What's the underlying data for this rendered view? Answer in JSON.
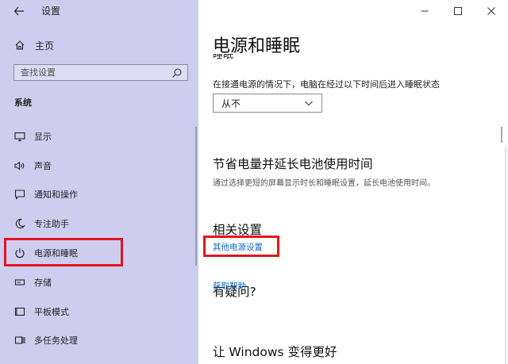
{
  "window": {
    "title": "设置",
    "controls": [
      "minimize",
      "maximize",
      "close"
    ]
  },
  "sidebar": {
    "home_label": "主页",
    "search_placeholder": "查找设置",
    "section": "系统",
    "items": [
      {
        "label": "显示",
        "icon": "display-icon"
      },
      {
        "label": "声音",
        "icon": "speaker-icon"
      },
      {
        "label": "通知和操作",
        "icon": "notification-icon"
      },
      {
        "label": "专注助手",
        "icon": "moon-icon"
      },
      {
        "label": "电源和睡眠",
        "icon": "power-icon",
        "selected": true
      },
      {
        "label": "存储",
        "icon": "storage-icon"
      },
      {
        "label": "平板模式",
        "icon": "tablet-icon"
      },
      {
        "label": "多任务处理",
        "icon": "multitask-icon"
      }
    ]
  },
  "main": {
    "title": "电源和睡眠",
    "subheading_cut": "睡眠",
    "sleep_label": "在接通电源的情况下，电脑在经过以下时间后进入睡眠状态",
    "sleep_value": "从不",
    "save_heading": "节省电量并延长电池使用时间",
    "save_desc": "通过选择更短的屏幕显示时长和睡眠设置，延长电池使用时间。",
    "related_heading": "相关设置",
    "related_link": "其他电源设置",
    "question_heading": "有疑问?",
    "help_link": "获取帮助",
    "improve_heading": "让 Windows 变得更好"
  },
  "colors": {
    "sidebar_bg": "#cfcdef",
    "link": "#1466c4",
    "highlight": "#e0161c"
  }
}
